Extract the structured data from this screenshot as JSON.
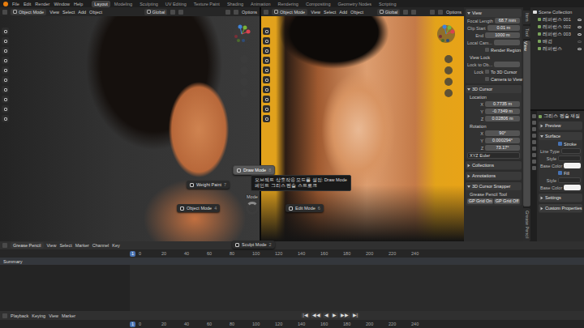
{
  "topbar": {
    "menus": [
      "File",
      "Edit",
      "Render",
      "Window",
      "Help"
    ],
    "workspaces": [
      {
        "label": "Layout",
        "selected": true
      },
      {
        "label": "Modeling",
        "selected": false
      },
      {
        "label": "Sculpting",
        "selected": false
      },
      {
        "label": "UV Editing",
        "selected": false
      },
      {
        "label": "Texture Paint",
        "selected": false
      },
      {
        "label": "Shading",
        "selected": false
      },
      {
        "label": "Animation",
        "selected": false
      },
      {
        "label": "Rendering",
        "selected": false
      },
      {
        "label": "Compositing",
        "selected": false
      },
      {
        "label": "Geometry Nodes",
        "selected": false
      },
      {
        "label": "Scripting",
        "selected": false
      }
    ]
  },
  "viewports": [
    {
      "mode": "Object Mode",
      "menus": [
        "View",
        "Select",
        "Add",
        "Object"
      ],
      "orientation": "Global",
      "options": "Options"
    },
    {
      "mode": "Object Mode",
      "menus": [
        "View",
        "Select",
        "Add",
        "Object"
      ],
      "orientation": "Global",
      "options": "Options"
    }
  ],
  "sidebar": {
    "tabs": [
      {
        "label": "Item",
        "selected": false
      },
      {
        "label": "Tool",
        "selected": false
      },
      {
        "label": "View",
        "selected": true
      },
      {
        "label": "Grease Pencil",
        "selected": false
      }
    ],
    "sections": [
      {
        "title": "View",
        "expanded": true,
        "rows": [
          {
            "kind": "field",
            "label": "Focal Length",
            "value": "68.7 mm"
          },
          {
            "kind": "field",
            "label": "Clip Start",
            "value": "0.01 m"
          },
          {
            "kind": "field",
            "label": "End",
            "value": "1000 m"
          },
          {
            "kind": "field",
            "label": "Local Cam..."
          },
          {
            "kind": "check",
            "text": "Render Region",
            "checked": false
          },
          {
            "kind": "heading",
            "label": "View Lock"
          },
          {
            "kind": "field",
            "label": "Lock to Ob..."
          },
          {
            "kind": "check",
            "label": "Lock",
            "text": "To 3D Cursor",
            "checked": false
          },
          {
            "kind": "check",
            "text": "Camera to View",
            "checked": false
          }
        ]
      },
      {
        "title": "3D Cursor",
        "expanded": true,
        "rows": [
          {
            "kind": "heading",
            "label": "Location"
          },
          {
            "kind": "field",
            "label": "X",
            "value": "0.7735 m"
          },
          {
            "kind": "field",
            "label": "Y",
            "value": "-0.7349 m"
          },
          {
            "kind": "field",
            "label": "Z",
            "value": "0.02806 m"
          },
          {
            "kind": "heading",
            "label": "Rotation"
          },
          {
            "kind": "field",
            "label": "X",
            "value": "90°"
          },
          {
            "kind": "field",
            "label": "Y",
            "value": "0.000294°"
          },
          {
            "kind": "field",
            "label": "Z",
            "value": "73.17°"
          },
          {
            "kind": "select",
            "value": "XYZ Euler"
          }
        ]
      },
      {
        "title": "Collections",
        "expanded": false
      },
      {
        "title": "Annotations",
        "expanded": false
      },
      {
        "title": "3D Cursor Snapper",
        "expanded": true,
        "rows": [
          {
            "kind": "heading",
            "label": "Grease Pencil Tool"
          },
          {
            "kind": "buttons",
            "buttons": [
              "GP Grid On",
              "GP Grid Off"
            ]
          }
        ]
      }
    ]
  },
  "outliner": {
    "title": "Scene Collection",
    "items": [
      {
        "label": "레퍼런스 001",
        "visible": true
      },
      {
        "label": "레퍼런스 002",
        "visible": true
      },
      {
        "label": "레퍼런스 003",
        "visible": true
      },
      {
        "label": "배경",
        "visible": false
      },
      {
        "label": "레퍼런스",
        "visible": true
      }
    ]
  },
  "properties": {
    "material": "그리스 펜슬 재질",
    "sections": [
      {
        "title": "Preview",
        "expanded": false
      },
      {
        "title": "Surface",
        "expanded": true,
        "rows": [
          {
            "kind": "check",
            "text": "Stroke",
            "checked": true
          },
          {
            "kind": "select",
            "label": "Line Type"
          },
          {
            "kind": "select",
            "label": "Style"
          },
          {
            "kind": "color",
            "label": "Base Color"
          },
          {
            "kind": "check",
            "text": "Fill",
            "checked": true
          },
          {
            "kind": "select",
            "label": "Style"
          },
          {
            "kind": "color",
            "label": "Base Color"
          }
        ]
      },
      {
        "title": "Settings",
        "expanded": false
      },
      {
        "title": "Custom Properties",
        "expanded": false
      }
    ]
  },
  "pie_menu": {
    "title": "Mode",
    "items": [
      {
        "label": "Draw Mode",
        "key": "8",
        "selected": true
      },
      {
        "label": "Weight Paint",
        "key": "7",
        "selected": false
      },
      {
        "label": "Object Mode",
        "key": "4",
        "selected": false
      },
      {
        "label": "Edit Mode",
        "key": "6",
        "selected": false
      },
      {
        "label": "Sculpt Mode",
        "key": "2",
        "selected": false
      }
    ],
    "tooltip": [
      "오브젝트 상호작용 모드를 설정: Draw Mode",
      "페인트 그리스 펜슬 스트로크"
    ]
  },
  "timeline": {
    "editor": "Grease Pencil",
    "menus": [
      "View",
      "Select",
      "Marker",
      "Channel",
      "Key"
    ],
    "current_frame": "1",
    "ruler": [
      "0",
      "20",
      "40",
      "60",
      "80",
      "100",
      "120",
      "140",
      "160",
      "180",
      "200",
      "220",
      "240"
    ],
    "channels": [
      "Summary"
    ]
  },
  "playback": {
    "menus": [
      "Playback",
      "Keying",
      "View",
      "Marker"
    ],
    "buttons": [
      "|◀",
      "◀◀",
      "◀",
      "▶",
      "▶▶",
      "▶|"
    ],
    "current_frame": "1",
    "ruler": [
      "0",
      "20",
      "40",
      "60",
      "80",
      "100",
      "120",
      "140",
      "160",
      "180",
      "200",
      "220",
      "240"
    ]
  }
}
